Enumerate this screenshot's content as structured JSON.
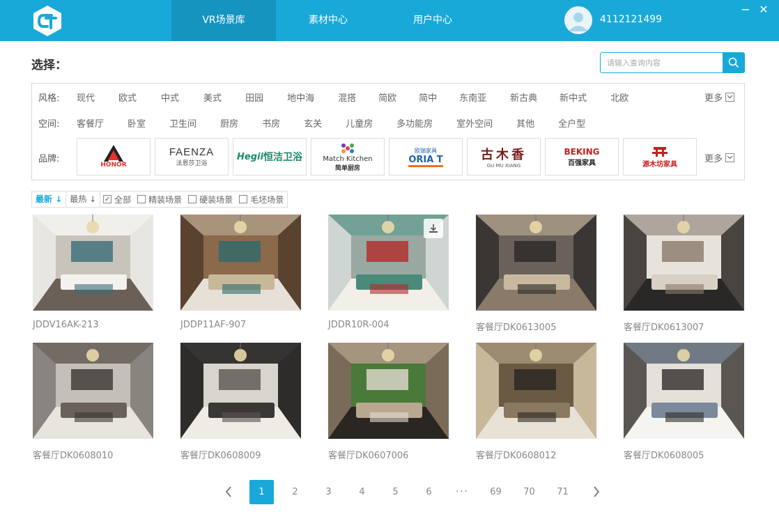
{
  "header": {
    "nav": [
      "VR场景库",
      "素材中心",
      "用户中心"
    ],
    "active_nav": 0,
    "username": "4112121499",
    "minimize": "−",
    "close": "✕"
  },
  "select_title": "选择：",
  "search": {
    "placeholder": "请输入查询内容"
  },
  "filters": {
    "style": {
      "label": "风格:",
      "items": [
        "现代",
        "欧式",
        "中式",
        "美式",
        "田园",
        "地中海",
        "混搭",
        "简欧",
        "简中",
        "东南亚",
        "新古典",
        "新中式",
        "北欧"
      ],
      "more": "更多"
    },
    "space": {
      "label": "空间:",
      "items": [
        "客餐厅",
        "卧室",
        "卫生间",
        "厨房",
        "书房",
        "玄关",
        "儿童房",
        "多功能房",
        "室外空间",
        "其他",
        "全户型"
      ]
    },
    "brand": {
      "label": "品牌:",
      "more": "更多",
      "items": [
        {
          "name": "HONOR",
          "icon": "honor-logo"
        },
        {
          "name": "FAENZA",
          "sub": "法恩莎卫浴",
          "icon": "faenza-logo"
        },
        {
          "name": "恒洁卫浴",
          "prefix": "Hegii",
          "icon": "hegii-logo"
        },
        {
          "name": "Match Kitchen",
          "sub": "简单厨房",
          "icon": "match-kitchen-logo"
        },
        {
          "name": "ORIA T",
          "sub": "欧瑞家具",
          "icon": "oriat-logo"
        },
        {
          "name": "古木香",
          "sub": "GU MU XIANG",
          "icon": "gumuxiang-logo"
        },
        {
          "name": "BEKING",
          "sub": "百强家具",
          "icon": "beking-logo"
        },
        {
          "name": "源木坊家具",
          "icon": "yuanmufang-logo"
        }
      ]
    }
  },
  "sort": {
    "latest": "最新",
    "hottest": "最热",
    "checks": [
      {
        "label": "全部",
        "checked": true
      },
      {
        "label": "精装场景",
        "checked": false
      },
      {
        "label": "硬装场景",
        "checked": false
      },
      {
        "label": "毛坯场景",
        "checked": false
      }
    ]
  },
  "scenes": [
    "JDDV16AK-213",
    "JDDP11AF-907",
    "JDDR10R-004",
    "客餐厅DK0613005",
    "客餐厅DK0613007",
    "客餐厅DK0608010",
    "客餐厅DK0608009",
    "客餐厅DK0607006",
    "客餐厅DK0608012",
    "客餐厅DK0608005"
  ],
  "pagination": {
    "prev": "‹",
    "next": "›",
    "pages": [
      "1",
      "2",
      "3",
      "4",
      "5",
      "6",
      "69",
      "70",
      "71"
    ],
    "dots": "···",
    "active": "1"
  },
  "colors": {
    "accent": "#19a9d8",
    "accent_dark": "#1494bf"
  }
}
